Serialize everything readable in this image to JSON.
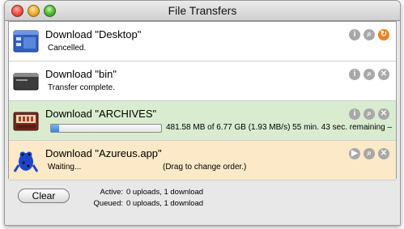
{
  "window": {
    "title": "File Transfers"
  },
  "transfers": [
    {
      "name": "Download \"Desktop\"",
      "status": "Cancelled.",
      "action_icon": "reload-icon"
    },
    {
      "name": "Download \"bin\"",
      "status": "Transfer complete."
    },
    {
      "name": "Download \"ARCHIVES\"",
      "progress_fraction": 0.07,
      "progress_text": "481.58 MB of 6.77 GB (1.93 MB/s) 55 min. 43 sec.  remaining –"
    },
    {
      "name": "Download \"Azureus.app\"",
      "status": "Waiting...",
      "hint": "(Drag to change order.)"
    }
  ],
  "footer": {
    "clear_label": "Clear",
    "active_label": "Active:",
    "active_value": "0 uploads, 1 download",
    "queued_label": "Queued:",
    "queued_value": "0 uploads, 1 download"
  },
  "colors": {
    "active_row": "#d9ecd0",
    "waiting_row": "#fbe9c8",
    "progress": "#3d82de",
    "reload": "#e88420"
  }
}
